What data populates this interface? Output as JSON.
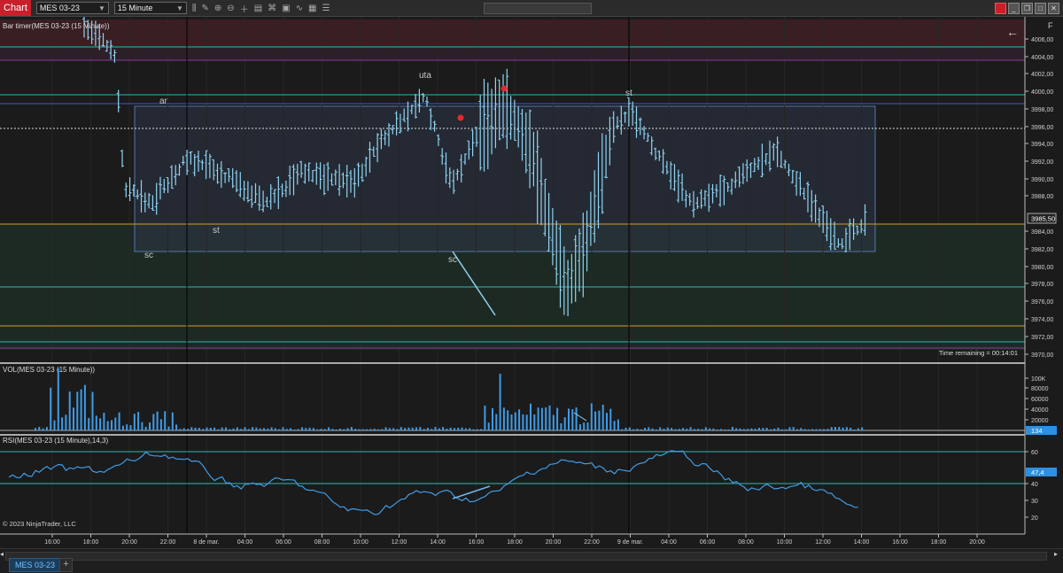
{
  "toolbar": {
    "chart_label": "Chart",
    "instrument": "MES 03-23",
    "interval": "15 Minute",
    "f_label": "F"
  },
  "panels": {
    "price_title": "Bar timer(MES 03-23 (15 Minute))",
    "vol_title": "VOL(MES 03-23 (15 Minute))",
    "rsi_title": "RSI(MES 03-23 (15 Minute),14,3)",
    "time_remaining": "Time remaining = 00:14:01",
    "copyright": "© 2023 NinjaTrader, LLC"
  },
  "price_axis": [
    "4006,00",
    "4004,00",
    "4002,00",
    "4000,00",
    "3998,00",
    "3996,00",
    "3994,00",
    "3992,00",
    "3990,00",
    "3988,00",
    "3984,00",
    "3982,00",
    "3980,00",
    "3978,00",
    "3976,00",
    "3974,00",
    "3972,00",
    "3970,00"
  ],
  "current_price": "3985,50",
  "vol_axis": [
    "100K",
    "80000",
    "60000",
    "40000",
    "20000"
  ],
  "vol_current": "134",
  "rsi_axis": [
    "60",
    "40",
    "30",
    "20"
  ],
  "rsi_current": "47,4",
  "time_axis": [
    "16:00",
    "18:00",
    "20:00",
    "22:00",
    "8 de mar.",
    "04:00",
    "06:00",
    "08:00",
    "10:00",
    "12:00",
    "14:00",
    "16:00",
    "18:00",
    "20:00",
    "22:00",
    "9 de mar.",
    "04:00",
    "06:00",
    "08:00",
    "10:00",
    "12:00",
    "14:00",
    "16:00",
    "18:00",
    "20:00"
  ],
  "annotations": [
    "ar",
    "sc",
    "st",
    "uta",
    "sc",
    "st"
  ],
  "status": {
    "tab": "MES 03-23"
  },
  "colors": {
    "accent_red": "#c8202a",
    "bar": "#8fd4f2",
    "level_cyan": "#2fb7b0",
    "level_orange": "#d99a2e",
    "rsi": "#3f9be6",
    "box": "#5577aa"
  }
}
